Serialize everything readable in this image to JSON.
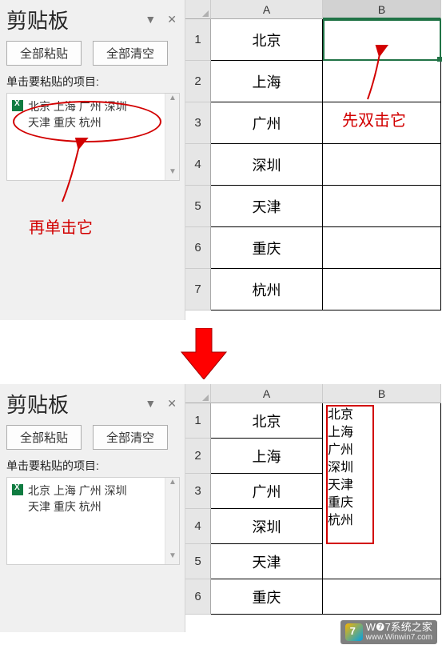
{
  "clipboard": {
    "title": "剪贴板",
    "paste_all_label": "全部粘贴",
    "clear_all_label": "全部清空",
    "section_label": "单击要粘贴的项目:",
    "item_line1": "北京 上海 广州 深圳",
    "item_line2": "天津 重庆 杭州"
  },
  "annotations": {
    "double_click": "先双击它",
    "then_click": "再单击它"
  },
  "columns": [
    "A",
    "B"
  ],
  "rows_top": [
    "1",
    "2",
    "3",
    "4",
    "5",
    "6",
    "7"
  ],
  "rows_bottom": [
    "1",
    "2",
    "3",
    "4",
    "5",
    "6"
  ],
  "data_top": {
    "A": [
      "北京",
      "上海",
      "广州",
      "深圳",
      "天津",
      "重庆",
      "杭州"
    ],
    "B": [
      "",
      "",
      "",
      "",
      "",
      "",
      ""
    ]
  },
  "data_bottom": {
    "A": [
      "北京",
      "上海",
      "广州",
      "深圳",
      "天津",
      "重庆"
    ],
    "B_merged": "北京\n上海\n广州\n深圳\n天津\n重庆\n杭州"
  },
  "watermark": {
    "line1": "W❼7系统之家",
    "line2": "www.Winwin7.com"
  },
  "colors": {
    "accent": "#217346",
    "annotation": "#d20000"
  }
}
